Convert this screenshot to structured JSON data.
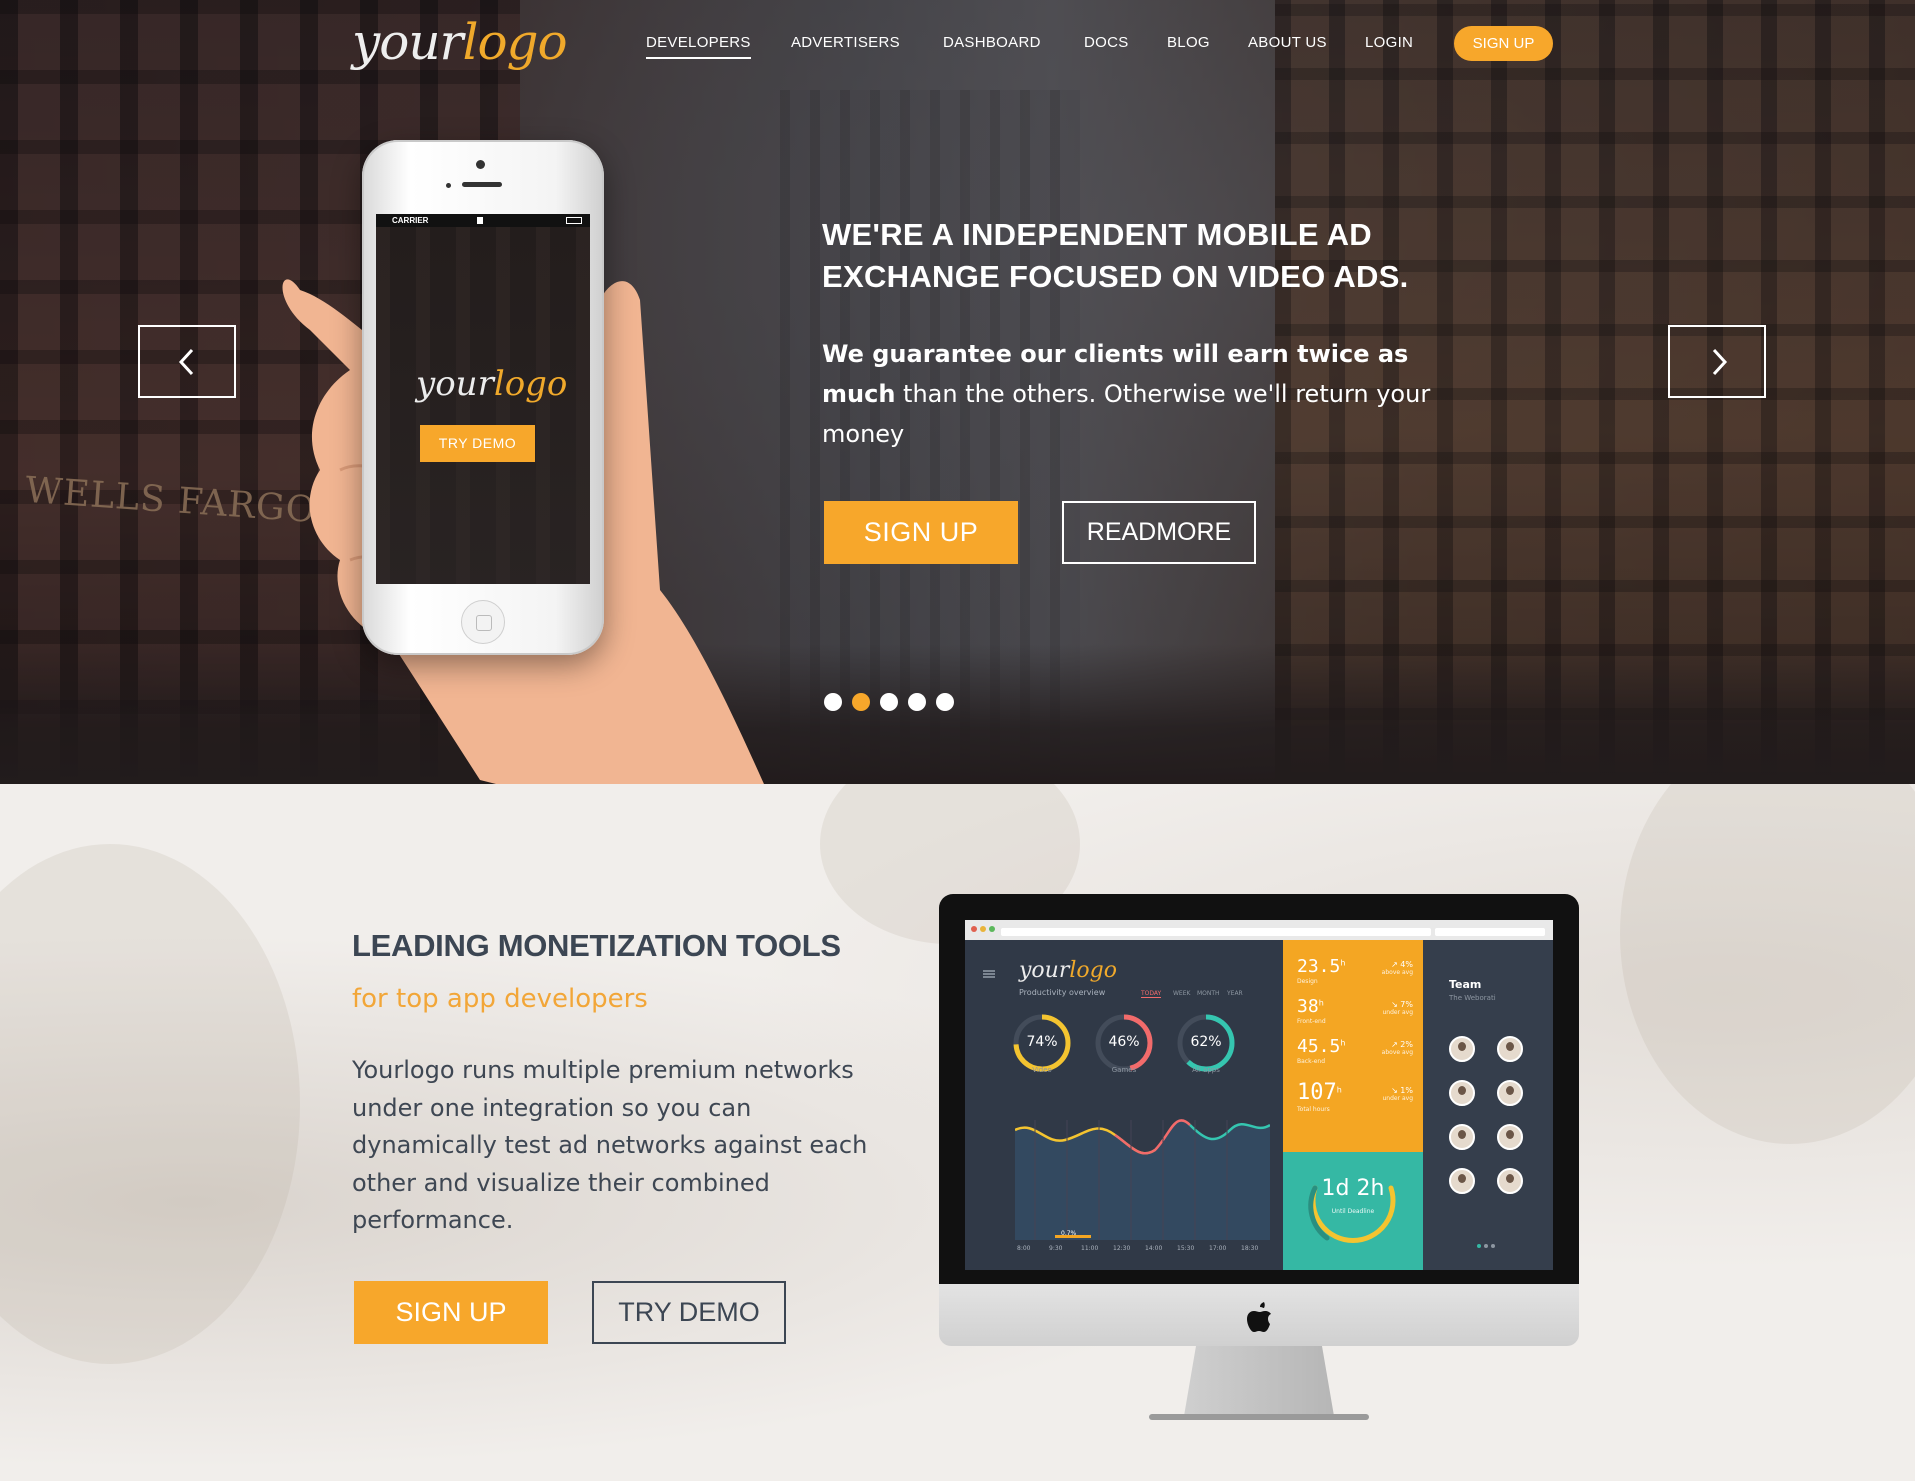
{
  "brand": {
    "logo_part1": "your",
    "logo_part2": "logo",
    "accent_color": "#f7a72b"
  },
  "nav": {
    "items": [
      {
        "label": "DEVELOPERS",
        "active": true
      },
      {
        "label": "ADVERTISERS"
      },
      {
        "label": "DASHBOARD"
      },
      {
        "label": "DOCS"
      },
      {
        "label": "BLOG"
      },
      {
        "label": "ABOUT US"
      },
      {
        "label": "LOGIN"
      }
    ],
    "signup_label": "SIGN UP"
  },
  "hero": {
    "title_line1": "WE'RE A INDEPENDENT MOBILE AD",
    "title_line2": "EXCHANGE FOCUSED ON VIDEO ADS.",
    "subtitle_bold": "We guarantee our clients will earn twice as much",
    "subtitle_rest": " than the others. Otherwise we'll return your money",
    "signup_label": "SIGN UP",
    "readmore_label": "READMORE",
    "prev_icon": "chevron-left-icon",
    "next_icon": "chevron-right-icon",
    "slides": 5,
    "active_slide": 2,
    "background_sign": "WELLS FARGO",
    "phone": {
      "carrier": "CARRIER",
      "logo_part1": "your",
      "logo_part2": "logo",
      "demo_label": "TRY DEMO"
    }
  },
  "section": {
    "title": "LEADING MONETIZATION TOOLS",
    "subtitle": "for top app developers",
    "body": "Yourlogo runs multiple premium networks under one integration so you can dynamically test ad networks against each other and visualize their combined performance.",
    "signup_label": "SIGN UP",
    "demo_label": "TRY DEMO"
  },
  "dashboard": {
    "logo_part1": "your",
    "logo_part2": "logo",
    "overview_label": "Productivity overview",
    "tabs": [
      "TODAY",
      "WEEK",
      "MONTH",
      "YEAR"
    ],
    "rings": [
      {
        "value": "74%",
        "label": "Video",
        "pct": 74,
        "color": "#f4c430"
      },
      {
        "value": "46%",
        "label": "Games",
        "pct": 46,
        "color": "#f26b6b"
      },
      {
        "value": "62%",
        "label": "All apps",
        "pct": 62,
        "color": "#35c6b0"
      }
    ],
    "chart_marker": "0.7%",
    "x_ticks": [
      "8:00",
      "9:30",
      "11:00",
      "12:30",
      "14:00",
      "15:30",
      "17:00",
      "18:30"
    ],
    "stats": [
      {
        "value": "23.5",
        "unit": "h",
        "label": "Design",
        "delta": "↗ 4%",
        "delta_label": "above avg"
      },
      {
        "value": "38",
        "unit": "h",
        "label": "Front-end",
        "delta": "↘ 7%",
        "delta_label": "under avg"
      },
      {
        "value": "45.5",
        "unit": "h",
        "label": "Back-end",
        "delta": "↗ 2%",
        "delta_label": "above avg"
      },
      {
        "value": "107",
        "unit": "h",
        "label": "Total hours",
        "delta": "↘ 1%",
        "delta_label": "under avg"
      }
    ],
    "deadline_value": "1d 2h",
    "deadline_label": "Until Deadline",
    "team_title": "Team",
    "team_subtitle": "The Weborati"
  }
}
